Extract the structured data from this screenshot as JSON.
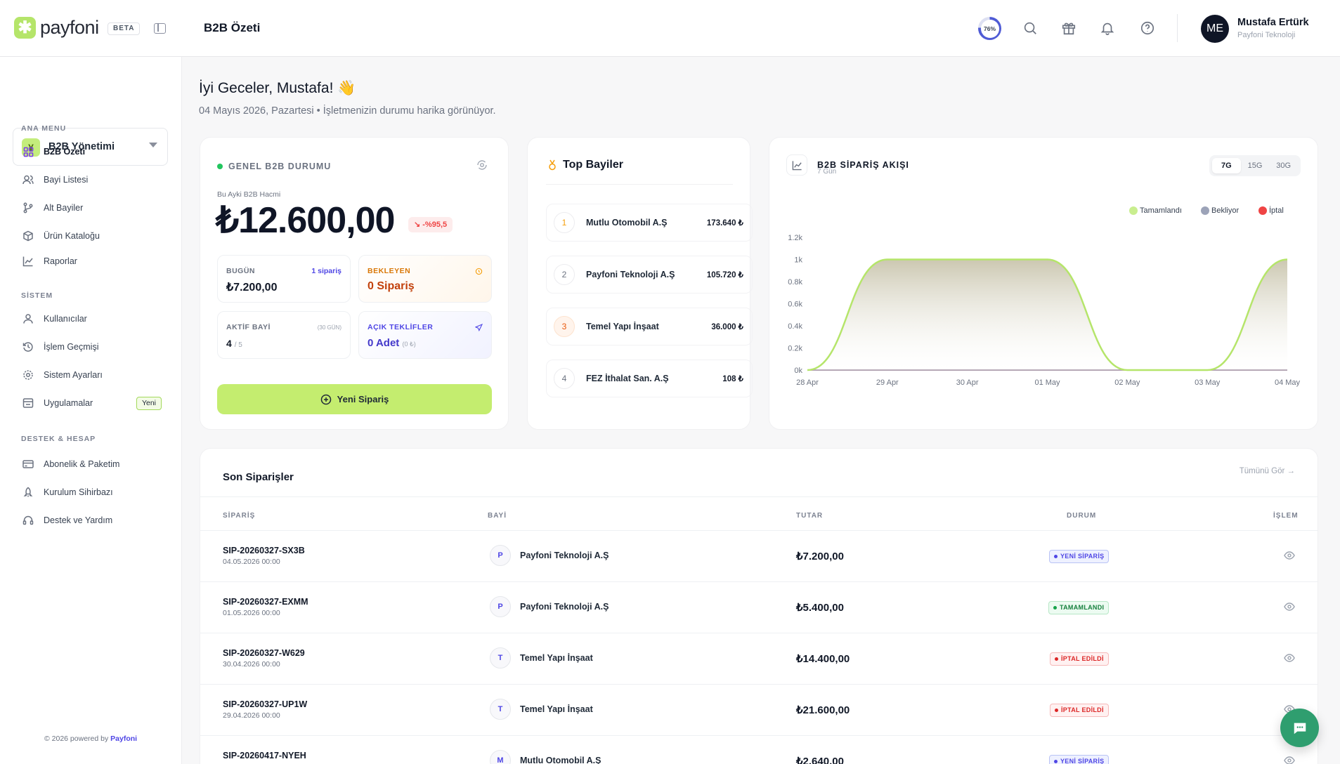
{
  "brand": {
    "name": "payfoni",
    "beta": "BETA"
  },
  "header": {
    "title": "B2B Özeti",
    "progress_label": "76%",
    "progress_value": 76,
    "user": {
      "initials": "ME",
      "name": "Mustafa Ertürk",
      "company": "Payfoni Teknoloji"
    }
  },
  "sidebar": {
    "workspace": "B2B Yönetimi",
    "sections": [
      {
        "title": "ANA MENU",
        "items": [
          {
            "label": "B2B Özeti",
            "icon": "grid-icon",
            "active": true
          },
          {
            "label": "Bayi Listesi",
            "icon": "users-icon"
          },
          {
            "label": "Alt Bayiler",
            "icon": "git-branch-icon"
          },
          {
            "label": "Ürün Kataloğu",
            "icon": "box-icon"
          },
          {
            "label": "Raporlar",
            "icon": "chart-line-icon"
          }
        ]
      },
      {
        "title": "SİSTEM",
        "items": [
          {
            "label": "Kullanıcılar",
            "icon": "user-icon"
          },
          {
            "label": "İşlem Geçmişi",
            "icon": "history-icon"
          },
          {
            "label": "Sistem Ayarları",
            "icon": "gear-icon"
          },
          {
            "label": "Uygulamalar",
            "icon": "store-icon",
            "badge": "Yeni"
          }
        ]
      },
      {
        "title": "DESTEK & HESAP",
        "items": [
          {
            "label": "Abonelik & Paketim",
            "icon": "credit-card-icon"
          },
          {
            "label": "Kurulum Sihirbazı",
            "icon": "rocket-icon"
          },
          {
            "label": "Destek ve Yardım",
            "icon": "headset-icon"
          }
        ]
      }
    ],
    "footer": {
      "text": "© 2026 powered by ",
      "brand": "Payfoni"
    }
  },
  "greeting": {
    "title": "İyi Geceler, Mustafa! 👋",
    "subtitle": "04 Mayıs 2026, Pazartesi • İşletmenizin durumu harika görünüyor."
  },
  "status_card": {
    "title": "GENEL B2B DURUMU",
    "volume_label": "Bu Ayki B2B Hacmi",
    "volume": "₺12.600,00",
    "trend": "↘ -%95,5",
    "today": {
      "label": "BUGÜN",
      "value": "₺7.200,00",
      "extra": "1 sipariş"
    },
    "pending": {
      "label": "BEKLEYEN",
      "value": "0 Sipariş"
    },
    "active_dealers": {
      "label": "AKTİF BAYİ",
      "value": "4",
      "suffix": "/ 5",
      "extra": "(30 GÜN)"
    },
    "open_offers": {
      "label": "AÇIK TEKLİFLER",
      "value": "0 Adet",
      "suffix": "(0 ₺)"
    },
    "button": "Yeni Sipariş"
  },
  "top_dealers": {
    "title": "Top Bayiler",
    "items": [
      {
        "rank": "1",
        "name": "Mutlu Otomobil A.Ş",
        "value": "173.640 ₺"
      },
      {
        "rank": "2",
        "name": "Payfoni Teknoloji A.Ş",
        "value": "105.720 ₺"
      },
      {
        "rank": "3",
        "name": "Temel Yapı İnşaat",
        "value": "36.000 ₺"
      },
      {
        "rank": "4",
        "name": "FEZ İthalat San. A.Ş",
        "value": "108 ₺"
      }
    ]
  },
  "order_flow": {
    "title": "B2B SİPARİŞ AKIŞI",
    "subtitle": "7 Gün",
    "tabs": [
      "7G",
      "15G",
      "30G"
    ],
    "active_tab": "7G"
  },
  "chart_data": {
    "type": "area",
    "x": [
      "28 Apr",
      "29 Apr",
      "30 Apr",
      "01 May",
      "02 May",
      "03 May",
      "04 May"
    ],
    "series": [
      {
        "name": "Tamamlandı",
        "color": "#b5e56a",
        "values": [
          0,
          1000,
          1000,
          1000,
          0,
          0,
          1000
        ]
      },
      {
        "name": "Bekliyor",
        "color": "#9ca3b8",
        "values": [
          0,
          0,
          0,
          0,
          0,
          0,
          0
        ]
      },
      {
        "name": "İptal",
        "color": "#ef4444",
        "values": [
          0,
          0,
          0,
          0,
          0,
          0,
          0
        ]
      }
    ],
    "yticks": [
      "0k",
      "0.2k",
      "0.4k",
      "0.6k",
      "0.8k",
      "1k",
      "1.2k"
    ],
    "ylim": [
      0,
      1200
    ],
    "legend": "top-right",
    "grid": false
  },
  "orders": {
    "title": "Son Siparişler",
    "see_all": "Tümünü Gör →",
    "columns": [
      "SİPARİŞ",
      "BAYİ",
      "TUTAR",
      "DURUM",
      "İŞLEM"
    ],
    "rows": [
      {
        "id": "SIP-20260327-SX3B",
        "date": "04.05.2026 00:00",
        "initial": "P",
        "dealer": "Payfoni Teknoloji A.Ş",
        "amount": "₺7.200,00",
        "status": "YENİ SİPARİŞ",
        "kind": "new"
      },
      {
        "id": "SIP-20260327-EXMM",
        "date": "01.05.2026 00:00",
        "initial": "P",
        "dealer": "Payfoni Teknoloji A.Ş",
        "amount": "₺5.400,00",
        "status": "TAMAMLANDI",
        "kind": "done"
      },
      {
        "id": "SIP-20260327-W629",
        "date": "30.04.2026 00:00",
        "initial": "T",
        "dealer": "Temel Yapı İnşaat",
        "amount": "₺14.400,00",
        "status": "İPTAL EDİLDİ",
        "kind": "cancel"
      },
      {
        "id": "SIP-20260327-UP1W",
        "date": "29.04.2026 00:00",
        "initial": "T",
        "dealer": "Temel Yapı İnşaat",
        "amount": "₺21.600,00",
        "status": "İPTAL EDİLDİ",
        "kind": "cancel"
      },
      {
        "id": "SIP-20260417-NYEH",
        "date": "",
        "initial": "M",
        "dealer": "Mutlu Otomobil A.Ş",
        "amount": "₺2.640,00",
        "status": "YENİ SİPARİŞ",
        "kind": "new"
      }
    ]
  }
}
